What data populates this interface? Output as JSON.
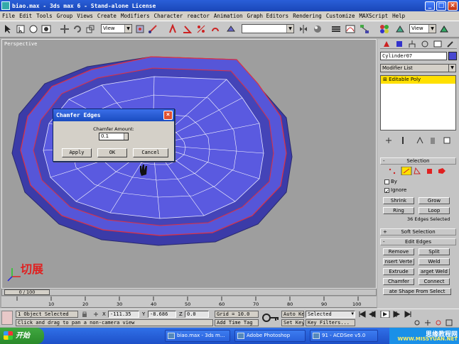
{
  "window": {
    "title": "biao.max - 3ds max 6 - Stand-alone License"
  },
  "menu": [
    "File",
    "Edit",
    "Tools",
    "Group",
    "Views",
    "Create",
    "Modifiers",
    "Character",
    "reactor",
    "Animation",
    "Graph Editors",
    "Rendering",
    "Customize",
    "MAXScript",
    "Help"
  ],
  "toolbar": {
    "view_combo": "View",
    "view_combo_2": "View"
  },
  "viewport": {
    "label": "Perspective",
    "watermark": "切展"
  },
  "dialog": {
    "title": "Chamfer Edges",
    "amount_label": "Chamfer Amount:",
    "amount_value": "0.1",
    "apply": "Apply",
    "ok": "OK",
    "cancel": "Cancel"
  },
  "command_panel": {
    "object_name": "Cylinder07",
    "modifier_list": "Modifier List",
    "stack_item": "Editable Poly",
    "selection": {
      "title": "Selection",
      "by_label": "By",
      "ignore_label": "Ignore",
      "shrink": "Shrink",
      "grow": "Grow",
      "ring": "Ring",
      "loop": "Loop",
      "status": "36 Edges Selected"
    },
    "soft_selection": "Soft Selection",
    "edit_edges": {
      "title": "Edit Edges",
      "remove": "Remove",
      "split": "Split",
      "insert_vertex": "nsert Verte",
      "weld": "Weld",
      "extrude": "Extrude",
      "target_weld": "arget Weld",
      "chamfer": "Chamfer",
      "connect": "Connect",
      "create_shape": "ate Shape From Select"
    }
  },
  "timeline": {
    "frame": "0 / 100",
    "ticks": [
      "10",
      "20",
      "30",
      "40",
      "50",
      "60",
      "70",
      "80",
      "90",
      "100"
    ]
  },
  "status": {
    "selection": "1 Object Selected",
    "prompt": "Click and drag to pan a non-camera view",
    "x_label": "X",
    "x_value": "-111.35",
    "y_label": "Y",
    "y_value": "-8.686",
    "z_label": "Z",
    "z_value": "0.0",
    "grid": "Grid = 10.0",
    "add_time_tag": "Add Time Tag",
    "auto_key": "Auto Key",
    "set_key": "Set Key",
    "selected": "Selected",
    "key_filters": "Key Filters..."
  },
  "taskbar": {
    "start": "开始",
    "tasks": [
      "biao.max - 3ds m...",
      "Adobe Photoshop",
      "91 - ACDSee v5.0"
    ],
    "watermark": "思缘教程网",
    "watermark_url": "WWW.MISSYUAN.NET"
  },
  "colors": {
    "poly": "#5656d8",
    "edge_sel": "#e03040",
    "bg": "#9e9e9e"
  }
}
